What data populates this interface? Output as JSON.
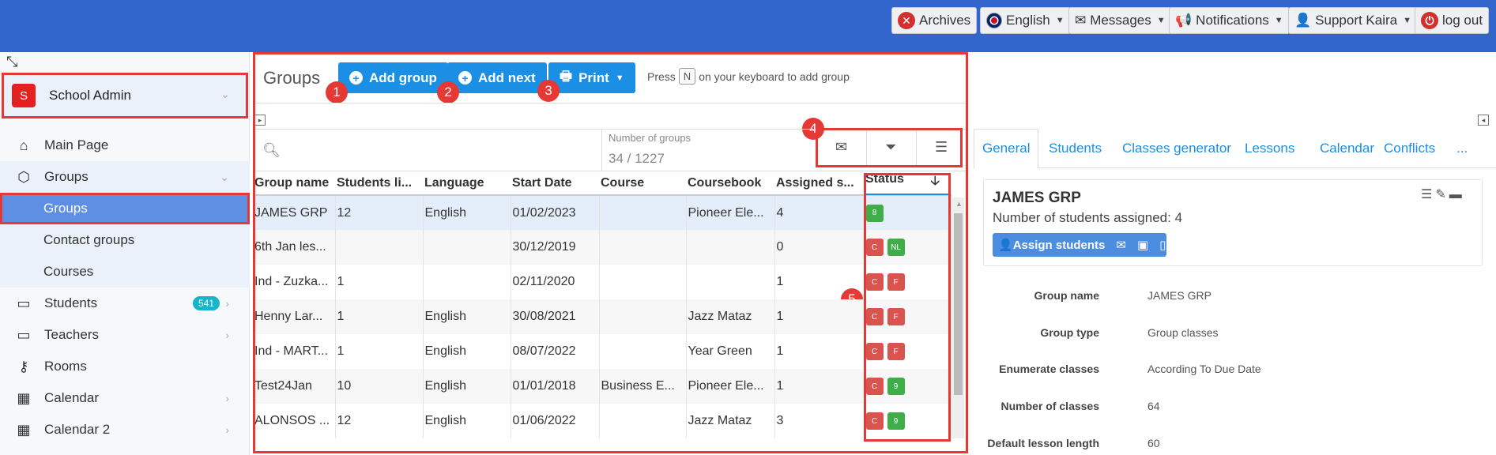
{
  "topbar": {
    "archives": "Archives",
    "language": "English",
    "messages": "Messages",
    "notifications": "Notifications",
    "user": "Support Kaira",
    "logout": "log out"
  },
  "sidebar": {
    "school_initial": "S",
    "school_name": "School Admin",
    "items": [
      {
        "label": "Main Page"
      },
      {
        "label": "Groups"
      },
      {
        "label": "Groups"
      },
      {
        "label": "Contact groups"
      },
      {
        "label": "Courses"
      },
      {
        "label": "Students",
        "badge": "541"
      },
      {
        "label": "Teachers"
      },
      {
        "label": "Rooms"
      },
      {
        "label": "Calendar"
      },
      {
        "label": "Calendar 2"
      }
    ]
  },
  "main": {
    "title": "Groups",
    "add_group": "Add group",
    "add_next": "Add next",
    "print": "Print",
    "hint_pre": "Press",
    "hint_key": "N",
    "hint_post": "on your keyboard to add group",
    "num_groups_label": "Number of groups",
    "num_groups_value": "34 / 1227"
  },
  "callouts": [
    "1",
    "2",
    "3",
    "4",
    "5"
  ],
  "table": {
    "columns": [
      "Group name",
      "Students li...",
      "Language",
      "Start Date",
      "Course",
      "Coursebook",
      "Assigned s...",
      "Status"
    ],
    "rows": [
      {
        "name": "JAMES GRP",
        "students": "12",
        "language": "English",
        "start": "01/02/2023",
        "course": "",
        "coursebook": "Pioneer Ele...",
        "assigned": "4",
        "status": [
          {
            "t": "8",
            "c": "g"
          }
        ]
      },
      {
        "name": "6th Jan les...",
        "students": "",
        "language": "",
        "start": "30/12/2019",
        "course": "",
        "coursebook": "",
        "assigned": "0",
        "status": [
          {
            "t": "C",
            "c": "r"
          },
          {
            "t": "NL",
            "c": "g"
          }
        ]
      },
      {
        "name": "Ind - Zuzka...",
        "students": "1",
        "language": "",
        "start": "02/11/2020",
        "course": "",
        "coursebook": "",
        "assigned": "1",
        "status": [
          {
            "t": "C",
            "c": "r"
          },
          {
            "t": "F",
            "c": "r"
          }
        ]
      },
      {
        "name": "Henny Lar...",
        "students": "1",
        "language": "English",
        "start": "30/08/2021",
        "course": "",
        "coursebook": "Jazz Mataz",
        "assigned": "1",
        "status": [
          {
            "t": "C",
            "c": "r"
          },
          {
            "t": "F",
            "c": "r"
          }
        ]
      },
      {
        "name": "Ind - MART...",
        "students": "1",
        "language": "English",
        "start": "08/07/2022",
        "course": "",
        "coursebook": "Year Green",
        "assigned": "1",
        "status": [
          {
            "t": "C",
            "c": "r"
          },
          {
            "t": "F",
            "c": "r"
          }
        ]
      },
      {
        "name": "Test24Jan",
        "students": "10",
        "language": "English",
        "start": "01/01/2018",
        "course": "Business E...",
        "coursebook": "Pioneer Ele...",
        "assigned": "1",
        "status": [
          {
            "t": "C",
            "c": "r"
          },
          {
            "t": "9",
            "c": "g"
          }
        ]
      },
      {
        "name": "ALONSOS ...",
        "students": "12",
        "language": "English",
        "start": "01/06/2022",
        "course": "",
        "coursebook": "Jazz Mataz",
        "assigned": "3",
        "status": [
          {
            "t": "C",
            "c": "r"
          },
          {
            "t": "9",
            "c": "g"
          }
        ]
      }
    ]
  },
  "right": {
    "tabs": [
      "General",
      "Students",
      "Classes generator",
      "Lessons",
      "Calendar",
      "Conflicts",
      "..."
    ],
    "card_title": "JAMES GRP",
    "card_sub": "Number of students assigned: 4",
    "assign": "Assign students",
    "props": [
      {
        "label": "Group name",
        "value": "JAMES GRP"
      },
      {
        "label": "Group type",
        "value": "Group classes"
      },
      {
        "label": "Enumerate classes",
        "value": "According To Due Date"
      },
      {
        "label": "Number of classes",
        "value": "64"
      },
      {
        "label": "Default lesson length",
        "value": "60"
      }
    ]
  },
  "colors": {
    "topbar": "#3366cc",
    "accent": "#1a8fe3",
    "highlight": "#e53935"
  }
}
